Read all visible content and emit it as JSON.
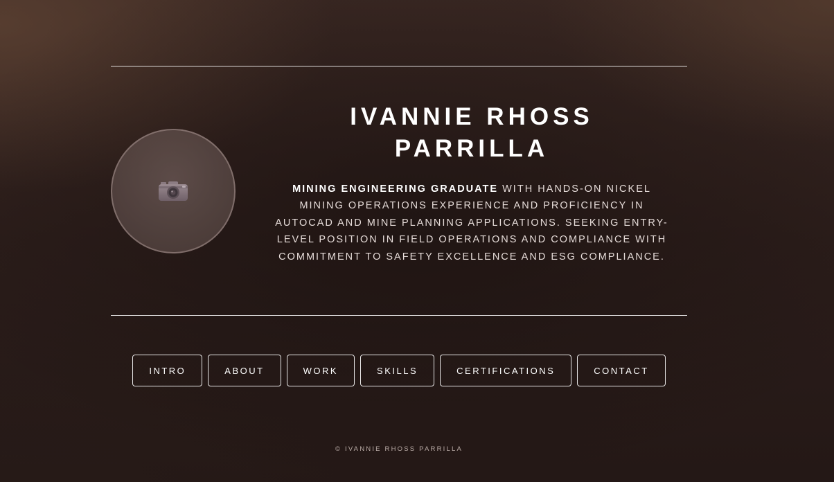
{
  "header": {
    "name_line1": "IVANNIE RHOSS",
    "name_line2": "PARRILLA"
  },
  "profile": {
    "avatar_icon": "camera-icon"
  },
  "summary": {
    "highlight": "MINING ENGINEERING GRADUATE",
    "text": " WITH HANDS-ON NICKEL MINING OPERATIONS EXPERIENCE AND PROFICIENCY IN AUTOCAD AND MINE PLANNING APPLICATIONS. SEEKING ENTRY-LEVEL POSITION IN FIELD OPERATIONS AND COMPLIANCE WITH COMMITMENT TO SAFETY EXCELLENCE AND ESG COMPLIANCE."
  },
  "nav": {
    "items": [
      {
        "label": "INTRO"
      },
      {
        "label": "ABOUT"
      },
      {
        "label": "WORK"
      },
      {
        "label": "SKILLS"
      },
      {
        "label": "CERTIFICATIONS"
      },
      {
        "label": "CONTACT"
      }
    ]
  },
  "footer": {
    "copyright": "© IVANNIE RHOSS PARRILLA"
  },
  "colors": {
    "background": "#2a1c19",
    "text": "#ffffff",
    "muted_text": "#e6dcd9"
  }
}
